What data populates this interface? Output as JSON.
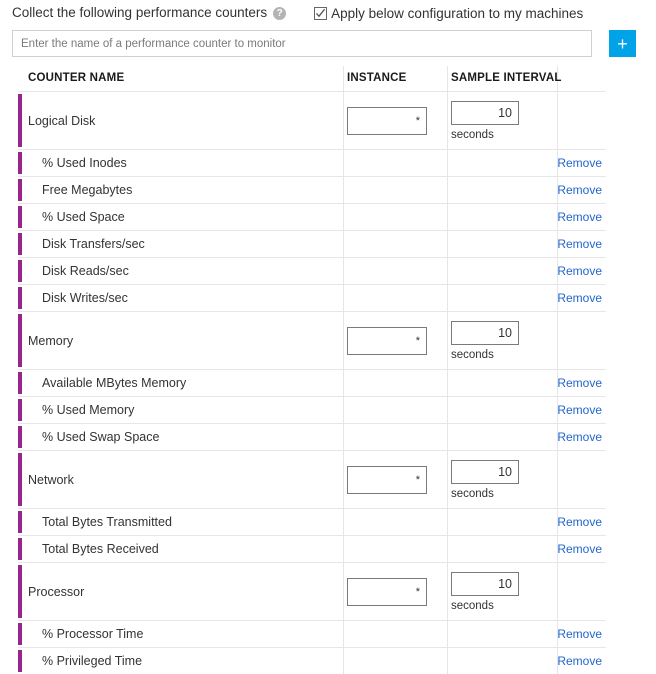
{
  "header": {
    "collect_label": "Collect the following performance counters",
    "help_icon": "help-icon",
    "help_glyph": "?",
    "apply_label": "Apply below configuration to my machines",
    "apply_checked": true
  },
  "search": {
    "placeholder": "Enter the name of a performance counter to monitor",
    "value": "",
    "add_button_label": "+",
    "add_button_color": "#00a2e8"
  },
  "table": {
    "columns": {
      "name": "COUNTER NAME",
      "instance": "INSTANCE",
      "interval": "SAMPLE INTERVAL",
      "actions": ""
    },
    "accent_color": "#99258c",
    "link_color": "#2266cc",
    "remove_label": "Remove",
    "interval_unit": "seconds",
    "groups": [
      {
        "name": "Logical Disk",
        "instance": "*",
        "interval": "10",
        "unit": "seconds",
        "children": [
          {
            "name": "% Used Inodes",
            "action": "Remove"
          },
          {
            "name": "Free Megabytes",
            "action": "Remove"
          },
          {
            "name": "% Used Space",
            "action": "Remove"
          },
          {
            "name": "Disk Transfers/sec",
            "action": "Remove"
          },
          {
            "name": "Disk Reads/sec",
            "action": "Remove"
          },
          {
            "name": "Disk Writes/sec",
            "action": "Remove"
          }
        ]
      },
      {
        "name": "Memory",
        "instance": "*",
        "interval": "10",
        "unit": "seconds",
        "children": [
          {
            "name": "Available MBytes Memory",
            "action": "Remove"
          },
          {
            "name": "% Used Memory",
            "action": "Remove"
          },
          {
            "name": "% Used Swap Space",
            "action": "Remove"
          }
        ]
      },
      {
        "name": "Network",
        "instance": "*",
        "interval": "10",
        "unit": "seconds",
        "children": [
          {
            "name": "Total Bytes Transmitted",
            "action": "Remove"
          },
          {
            "name": "Total Bytes Received",
            "action": "Remove"
          }
        ]
      },
      {
        "name": "Processor",
        "instance": "*",
        "interval": "10",
        "unit": "seconds",
        "children": [
          {
            "name": "% Processor Time",
            "action": "Remove"
          },
          {
            "name": "% Privileged Time",
            "action": "Remove"
          }
        ]
      }
    ]
  }
}
